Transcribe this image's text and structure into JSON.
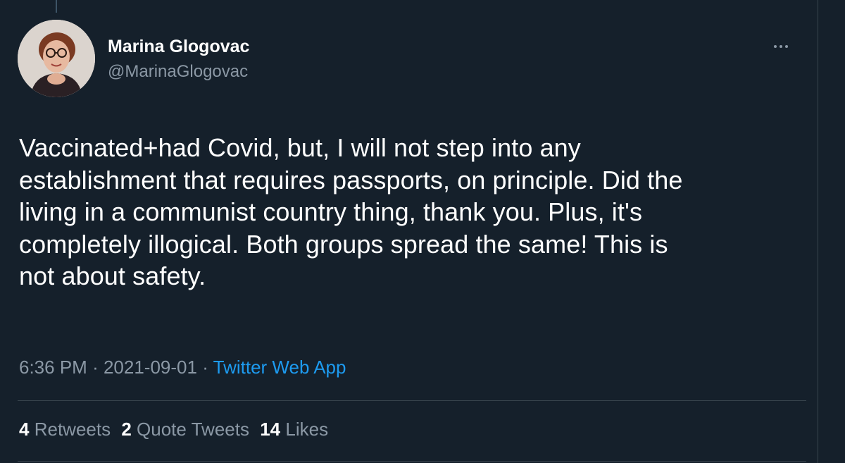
{
  "author": {
    "name": "Marina Glogovac",
    "handle": "@MarinaGlogovac"
  },
  "tweet": {
    "text": "Vaccinated+had Covid, but, I will not step into any\nestablishment that requires passports, on principle. Did the\nliving in a communist country thing, thank you. Plus, it's\ncompletely illogical. Both groups spread the same! This is\nnot about safety.",
    "time": "6:36 PM",
    "separator": "·",
    "date": "2021-09-01",
    "source": "Twitter Web App"
  },
  "stats": {
    "retweets_count": "4",
    "retweets_label": "Retweets",
    "quotes_count": "2",
    "quotes_label": "Quote Tweets",
    "likes_count": "14",
    "likes_label": "Likes"
  },
  "icons": {
    "more": "more-horizontal-icon"
  },
  "colors": {
    "background": "#15202b",
    "text_primary": "#ffffff",
    "text_secondary": "#8b98a5",
    "link": "#1d9bf0",
    "border": "#38444d"
  }
}
